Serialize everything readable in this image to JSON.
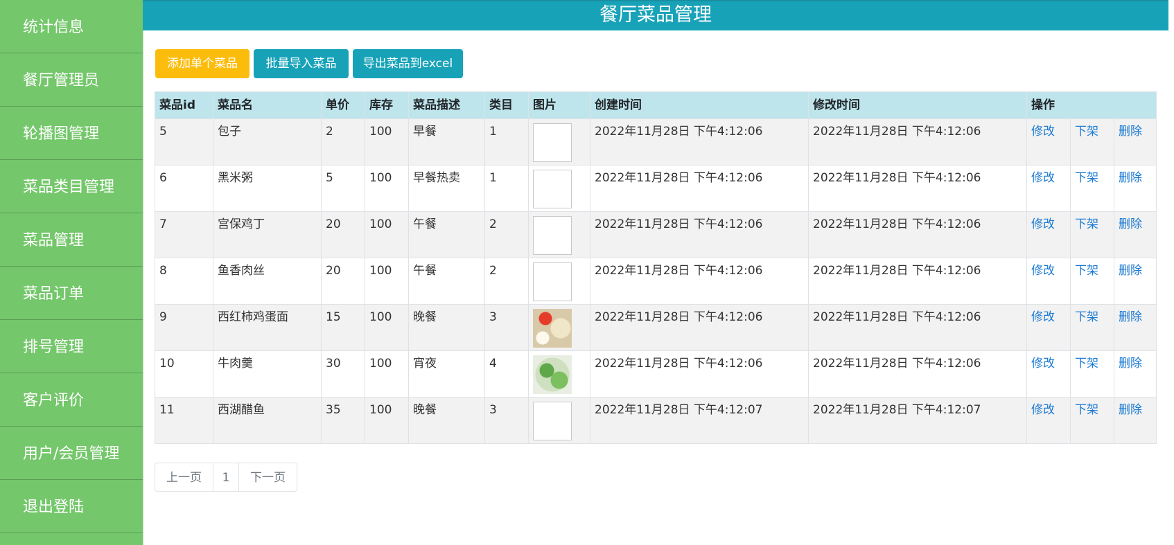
{
  "header": {
    "title": "餐厅菜品管理"
  },
  "sidebar": {
    "items": [
      {
        "label": "统计信息"
      },
      {
        "label": "餐厅管理员"
      },
      {
        "label": "轮播图管理"
      },
      {
        "label": "菜品类目管理"
      },
      {
        "label": "菜品管理"
      },
      {
        "label": "菜品订单"
      },
      {
        "label": "排号管理"
      },
      {
        "label": "客户评价"
      },
      {
        "label": "用户/会员管理"
      },
      {
        "label": "退出登陆"
      }
    ]
  },
  "toolbar": {
    "add_label": "添加单个菜品",
    "import_label": "批量导入菜品",
    "export_label": "导出菜品到excel",
    "add_color": "#fcbc0b",
    "import_color": "#17a2b8"
  },
  "table": {
    "columns": [
      "菜品id",
      "菜品名",
      "单价",
      "库存",
      "菜品描述",
      "类目",
      "图片",
      "创建时间",
      "修改时间",
      "操作"
    ],
    "rows": [
      {
        "id": "5",
        "name": "包子",
        "price": "2",
        "stock": "100",
        "desc": "早餐",
        "category": "1",
        "image": "broken-image-icon",
        "created": "2022年11月28日 下午4:12:06",
        "modified": "2022年11月28日 下午4:12:06",
        "edit": "修改",
        "offshelf": "下架",
        "delete": "删除"
      },
      {
        "id": "6",
        "name": "黑米粥",
        "price": "5",
        "stock": "100",
        "desc": "早餐热卖",
        "category": "1",
        "image": "broken-image-icon",
        "created": "2022年11月28日 下午4:12:06",
        "modified": "2022年11月28日 下午4:12:06",
        "edit": "修改",
        "offshelf": "下架",
        "delete": "删除"
      },
      {
        "id": "7",
        "name": "宫保鸡丁",
        "price": "20",
        "stock": "100",
        "desc": "午餐",
        "category": "2",
        "image": "broken-image-icon",
        "created": "2022年11月28日 下午4:12:06",
        "modified": "2022年11月28日 下午4:12:06",
        "edit": "修改",
        "offshelf": "下架",
        "delete": "删除"
      },
      {
        "id": "8",
        "name": "鱼香肉丝",
        "price": "20",
        "stock": "100",
        "desc": "午餐",
        "category": "2",
        "image": "broken-image-icon",
        "created": "2022年11月28日 下午4:12:06",
        "modified": "2022年11月28日 下午4:12:06",
        "edit": "修改",
        "offshelf": "下架",
        "delete": "删除"
      },
      {
        "id": "9",
        "name": "西红柿鸡蛋面",
        "price": "15",
        "stock": "100",
        "desc": "晚餐",
        "category": "3",
        "image": "tomato-noodle-photo",
        "created": "2022年11月28日 下午4:12:06",
        "modified": "2022年11月28日 下午4:12:06",
        "edit": "修改",
        "offshelf": "下架",
        "delete": "删除"
      },
      {
        "id": "10",
        "name": "牛肉羹",
        "price": "30",
        "stock": "100",
        "desc": "宵夜",
        "category": "4",
        "image": "beef-soup-photo",
        "created": "2022年11月28日 下午4:12:06",
        "modified": "2022年11月28日 下午4:12:06",
        "edit": "修改",
        "offshelf": "下架",
        "delete": "删除"
      },
      {
        "id": "11",
        "name": "西湖醋鱼",
        "price": "35",
        "stock": "100",
        "desc": "晚餐",
        "category": "3",
        "image": "broken-image-icon",
        "created": "2022年11月28日 下午4:12:07",
        "modified": "2022年11月28日 下午4:12:07",
        "edit": "修改",
        "offshelf": "下架",
        "delete": "删除"
      }
    ]
  },
  "pagination": {
    "prev": "上一页",
    "current": "1",
    "next": "下一页"
  }
}
